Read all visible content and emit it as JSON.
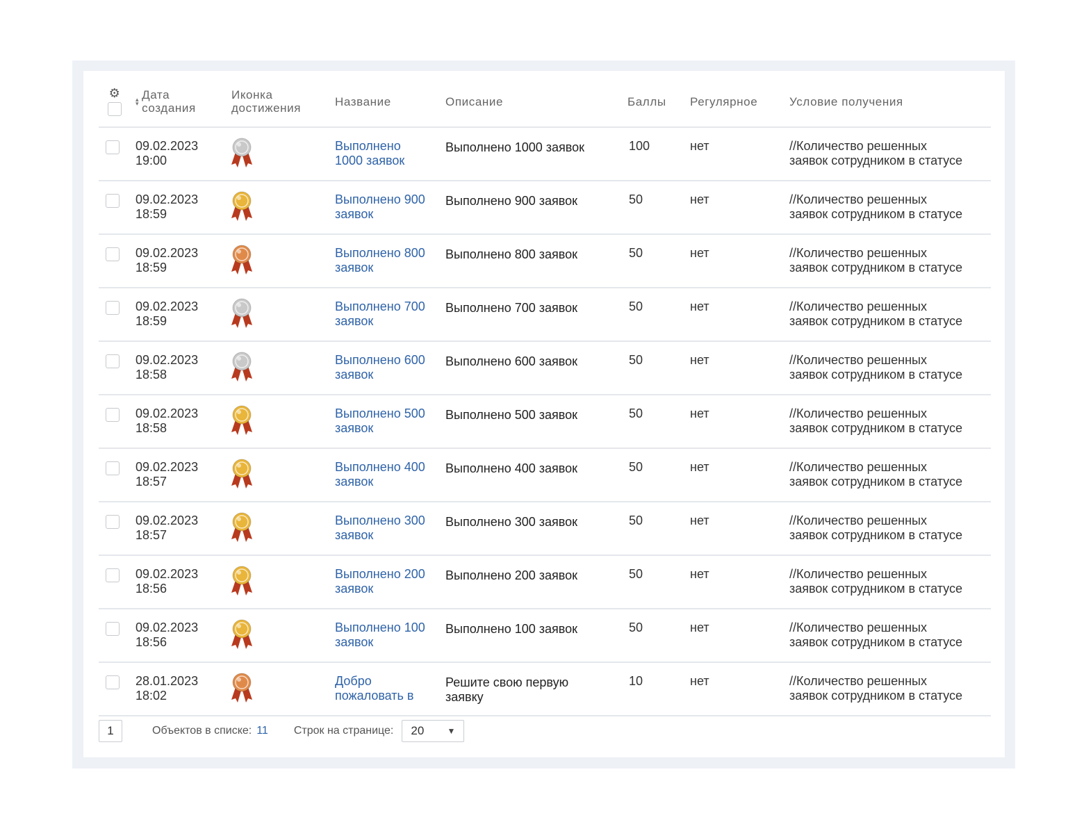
{
  "columns": {
    "date": [
      "Дата",
      "создания"
    ],
    "icon": [
      "Иконка",
      "достижения"
    ],
    "name": "Название",
    "desc": "Описание",
    "points": "Баллы",
    "regular": "Регулярное",
    "condition": "Условие получения"
  },
  "icons": {
    "settings": "gear-icon",
    "sort": "sort-icon",
    "medal": "medal-icon",
    "dropdown": "chevron-down-icon"
  },
  "colors": {
    "link": "#2f63a8",
    "medal_silver": "#c9c9c9",
    "medal_gold": "#e9b53a",
    "medal_bronze": "#e08a4a",
    "ribbon": "#b83a1e"
  },
  "rows": [
    {
      "date": "09.02.2023",
      "time": "19:00",
      "medal": "silver",
      "name": [
        "Выполнено",
        "1000 заявок"
      ],
      "desc": [
        "Выполнено 1000 заявок"
      ],
      "points": "100",
      "regular": "нет",
      "condition": [
        "//Количество решенных",
        "заявок сотрудником в статусе"
      ]
    },
    {
      "date": "09.02.2023",
      "time": "18:59",
      "medal": "gold",
      "name": [
        "Выполнено 900",
        "заявок"
      ],
      "desc": [
        "Выполнено 900 заявок"
      ],
      "points": "50",
      "regular": "нет",
      "condition": [
        "//Количество решенных",
        "заявок сотрудником в статусе"
      ]
    },
    {
      "date": "09.02.2023",
      "time": "18:59",
      "medal": "bronze",
      "name": [
        "Выполнено 800",
        "заявок"
      ],
      "desc": [
        "Выполнено 800 заявок"
      ],
      "points": "50",
      "regular": "нет",
      "condition": [
        "//Количество решенных",
        "заявок сотрудником в статусе"
      ]
    },
    {
      "date": "09.02.2023",
      "time": "18:59",
      "medal": "silver",
      "name": [
        "Выполнено 700",
        "заявок"
      ],
      "desc": [
        "Выполнено 700 заявок"
      ],
      "points": "50",
      "regular": "нет",
      "condition": [
        "//Количество решенных",
        "заявок сотрудником в статусе"
      ]
    },
    {
      "date": "09.02.2023",
      "time": "18:58",
      "medal": "silver",
      "name": [
        "Выполнено 600",
        "заявок"
      ],
      "desc": [
        "Выполнено 600 заявок"
      ],
      "points": "50",
      "regular": "нет",
      "condition": [
        "//Количество решенных",
        "заявок сотрудником в статусе"
      ]
    },
    {
      "date": "09.02.2023",
      "time": "18:58",
      "medal": "gold",
      "name": [
        "Выполнено 500",
        "заявок"
      ],
      "desc": [
        "Выполнено 500 заявок"
      ],
      "points": "50",
      "regular": "нет",
      "condition": [
        "//Количество решенных",
        "заявок сотрудником в статусе"
      ]
    },
    {
      "date": "09.02.2023",
      "time": "18:57",
      "medal": "gold",
      "name": [
        "Выполнено 400",
        "заявок"
      ],
      "desc": [
        "Выполнено 400 заявок"
      ],
      "points": "50",
      "regular": "нет",
      "condition": [
        "//Количество решенных",
        "заявок сотрудником в статусе"
      ]
    },
    {
      "date": "09.02.2023",
      "time": "18:57",
      "medal": "gold",
      "name": [
        "Выполнено 300",
        "заявок"
      ],
      "desc": [
        "Выполнено 300 заявок"
      ],
      "points": "50",
      "regular": "нет",
      "condition": [
        "//Количество решенных",
        "заявок сотрудником в статусе"
      ]
    },
    {
      "date": "09.02.2023",
      "time": "18:56",
      "medal": "gold",
      "name": [
        "Выполнено 200",
        "заявок"
      ],
      "desc": [
        "Выполнено 200 заявок"
      ],
      "points": "50",
      "regular": "нет",
      "condition": [
        "//Количество решенных",
        "заявок сотрудником в статусе"
      ]
    },
    {
      "date": "09.02.2023",
      "time": "18:56",
      "medal": "gold",
      "name": [
        "Выполнено 100",
        "заявок"
      ],
      "desc": [
        "Выполнено 100 заявок"
      ],
      "points": "50",
      "regular": "нет",
      "condition": [
        "//Количество решенных",
        "заявок сотрудником в статусе"
      ]
    },
    {
      "date": "28.01.2023",
      "time": "18:02",
      "medal": "bronze",
      "name": [
        "Добро",
        "пожаловать в"
      ],
      "desc": [
        "Решите свою первую",
        "заявку"
      ],
      "points": "10",
      "regular": "нет",
      "condition": [
        "//Количество решенных",
        "заявок сотрудником в статусе"
      ]
    }
  ],
  "footer": {
    "current_page": "1",
    "count_label": "Объектов в списке:",
    "count_value": "11",
    "rows_label": "Строк на странице:",
    "rows_value": "20"
  }
}
